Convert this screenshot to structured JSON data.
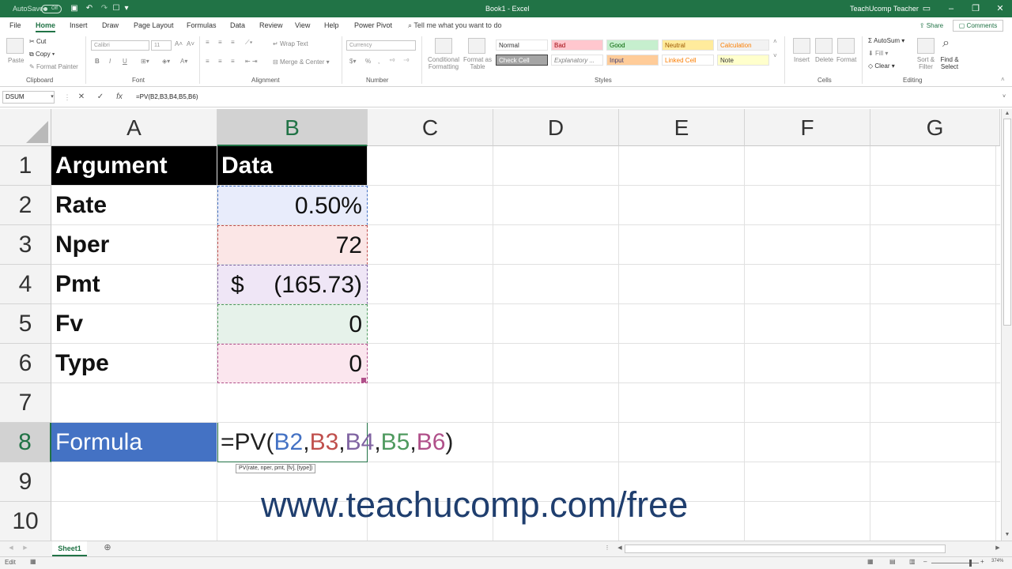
{
  "window": {
    "title": "Book1 - Excel",
    "user": "TeachUcomp Teacher",
    "autosave_label": "AutoSave",
    "autosave_state": "Off"
  },
  "tabs": [
    "File",
    "Home",
    "Insert",
    "Draw",
    "Page Layout",
    "Formulas",
    "Data",
    "Review",
    "View",
    "Help",
    "Power Pivot"
  ],
  "active_tab": "Home",
  "tell_me": "Tell me what you want to do",
  "share_label": "Share",
  "comments_label": "Comments",
  "ribbon": {
    "clipboard": {
      "paste": "Paste",
      "cut": "Cut",
      "copy": "Copy",
      "format_painter": "Format Painter",
      "label": "Clipboard"
    },
    "font": {
      "name": "Calibri",
      "size": "11",
      "bold": "B",
      "italic": "I",
      "underline": "U",
      "label": "Font"
    },
    "alignment": {
      "wrap": "Wrap Text",
      "merge": "Merge & Center",
      "label": "Alignment"
    },
    "number": {
      "format": "Currency",
      "label": "Number"
    },
    "styles": {
      "conditional": "Conditional Formatting",
      "format_as_table": "Format as Table",
      "cells": [
        "Normal",
        "Bad",
        "Good",
        "Neutral",
        "Calculation",
        "Check Cell",
        "Explanatory ...",
        "Input",
        "Linked Cell",
        "Note"
      ],
      "label": "Styles"
    },
    "cells": {
      "insert": "Insert",
      "delete": "Delete",
      "format": "Format",
      "label": "Cells"
    },
    "editing": {
      "autosum": "AutoSum",
      "fill": "Fill",
      "clear": "Clear",
      "sort_filter": "Sort & Filter",
      "find_select": "Find & Select",
      "label": "Editing"
    }
  },
  "formula_bar": {
    "name_box": "DSUM",
    "cancel": "✕",
    "enter": "✓",
    "fx": "fx",
    "formula": "=PV(B2,B3,B4,B5,B6)"
  },
  "columns": [
    "A",
    "B",
    "C",
    "D",
    "E",
    "F",
    "G"
  ],
  "rows": [
    "1",
    "2",
    "3",
    "4",
    "5",
    "6",
    "7",
    "8",
    "9",
    "10"
  ],
  "cells": {
    "A1": "Argument",
    "B1": "Data",
    "A2": "Rate",
    "B2": "0.50%",
    "A3": "Nper",
    "B3": "72",
    "A4": "Pmt",
    "B4_sym": "$",
    "B4_val": "(165.73)",
    "A5": "Fv",
    "B5": "0",
    "A6": "Type",
    "B6": "0",
    "A8": "Formula"
  },
  "edit": {
    "prefix": "=PV(",
    "refs": [
      {
        "text": "B2",
        "color": "#4472c4"
      },
      {
        "text": ",",
        "color": "#222222"
      },
      {
        "text": "B3",
        "color": "#c0504d"
      },
      {
        "text": ",",
        "color": "#222222"
      },
      {
        "text": "B4",
        "color": "#8064a2"
      },
      {
        "text": ",",
        "color": "#222222"
      },
      {
        "text": "B5",
        "color": "#4f9a5f"
      },
      {
        "text": ",",
        "color": "#222222"
      },
      {
        "text": "B6",
        "color": "#b0508a"
      }
    ],
    "suffix": ")",
    "tooltip": "PV(rate, nper, pmt, [fv], [type])"
  },
  "watermark": "www.teachucomp.com/free",
  "sheet_tab": "Sheet1",
  "status": {
    "mode": "Edit",
    "zoom": "374%"
  },
  "colors": {
    "excel_green": "#217346",
    "formula_blue": "#4472c4",
    "watermark": "#1f3e6e"
  }
}
